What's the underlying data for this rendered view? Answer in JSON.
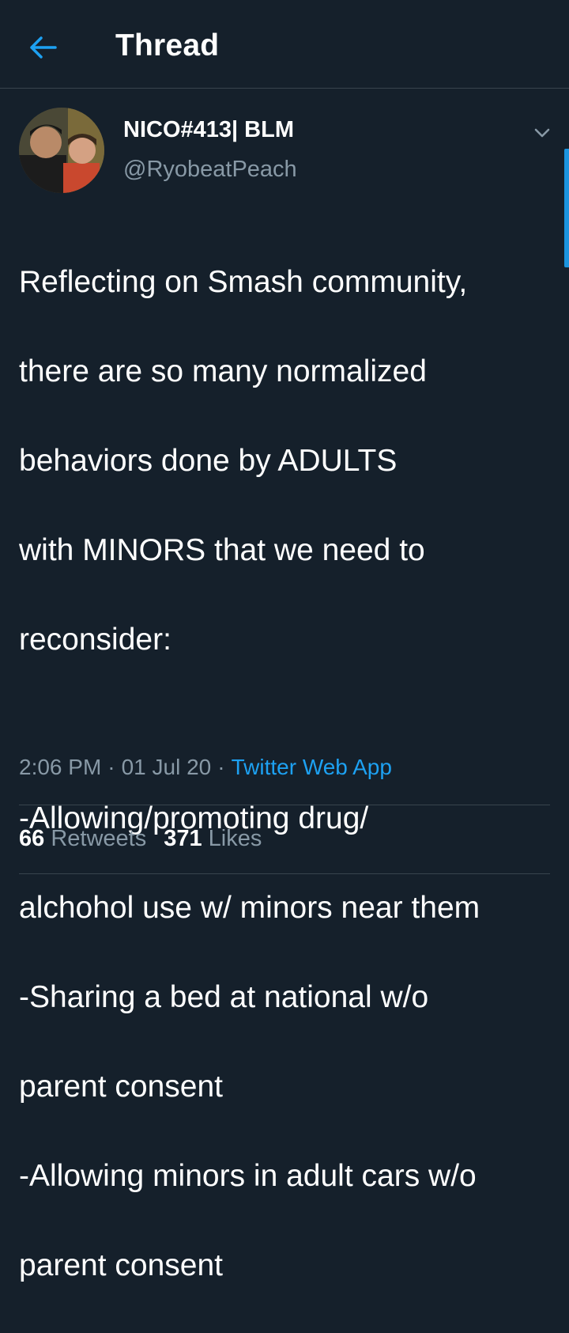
{
  "header": {
    "back_icon": "arrow-left-icon",
    "title": "Thread"
  },
  "colors": {
    "background": "#15202b",
    "accent": "#1da1f2",
    "secondary_text": "#8899a6",
    "divider": "#38444d"
  },
  "tweet": {
    "author": {
      "display_name": "NICO#413| BLM",
      "handle": "@RyobeatPeach",
      "avatar": "avatar-photo"
    },
    "menu_icon": "chevron-down-icon",
    "lines": [
      "Reflecting on Smash community,",
      "there are so many normalized",
      "behaviors done by ADULTS",
      "with MINORS that we need to",
      "reconsider:",
      "",
      "-Allowing/promoting drug/",
      "alchohol use w/ minors near them",
      "-Sharing a bed at national w/o",
      "parent consent",
      "-Allowing minors in adult cars w/o",
      "parent consent"
    ],
    "time": "2:06 PM",
    "date": "01 Jul 20",
    "separator": "·",
    "source": "Twitter Web App",
    "retweets": {
      "count": "66",
      "label": "Retweets"
    },
    "likes": {
      "count": "371",
      "label": "Likes"
    }
  }
}
